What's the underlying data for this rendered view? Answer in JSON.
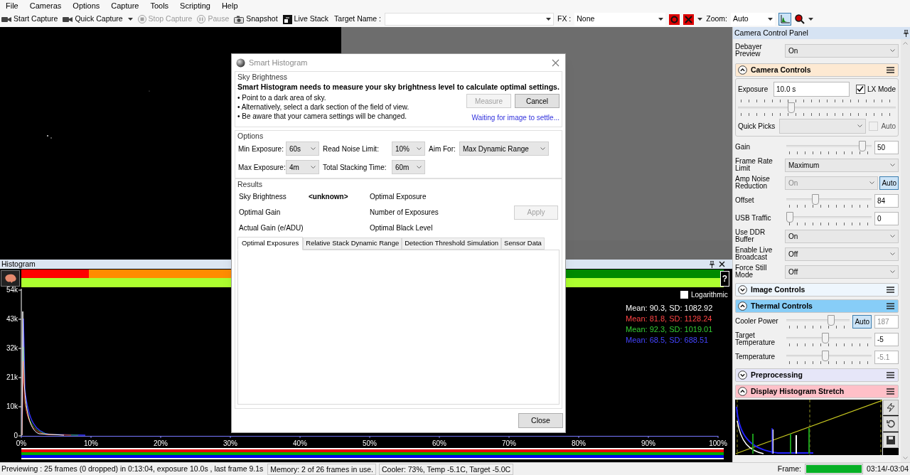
{
  "menu": [
    "File",
    "Cameras",
    "Options",
    "Capture",
    "Tools",
    "Scripting",
    "Help"
  ],
  "toolbar": {
    "buttons": [
      {
        "kind": "camera",
        "label": "Start Capture",
        "disabled": false,
        "has_menu": false
      },
      {
        "kind": "camera",
        "label": "Quick Capture",
        "disabled": false,
        "has_menu": true
      },
      {
        "kind": "stop",
        "label": "Stop Capture",
        "disabled": true,
        "has_menu": false
      },
      {
        "kind": "pause",
        "label": "Pause",
        "disabled": true,
        "has_menu": false
      },
      {
        "kind": "snapshot",
        "label": "Snapshot",
        "disabled": false,
        "has_menu": false
      },
      {
        "kind": "stack",
        "label": "Live Stack",
        "disabled": false,
        "has_menu": false
      }
    ],
    "target_name": {
      "label": "Target Name :"
    },
    "fx": {
      "label": "FX :",
      "value": "None"
    },
    "zoom": {
      "label": "Zoom:",
      "value": "Auto"
    },
    "histogram_toggle": {
      "selected": true
    }
  },
  "histogram": {
    "title": "Histogram",
    "help": "?",
    "logarithmic": {
      "label": "Logarithmic",
      "checked": false
    },
    "stats": [
      {
        "text": "Mean: 90.3, SD: 1082.92",
        "color": "#ffffff"
      },
      {
        "text": "Mean: 81.8, SD: 1128.24",
        "color": "#ff4444"
      },
      {
        "text": "Mean: 92.3, SD: 1019.01",
        "color": "#33cc33"
      },
      {
        "text": "Mean: 68.5, SD: 688.51",
        "color": "#4444ff"
      }
    ],
    "y_ticks": [
      "54k",
      "43k",
      "32k",
      "21k",
      "10k",
      "0"
    ],
    "x_ticks": [
      "0%",
      "10%",
      "20%",
      "30%",
      "40%",
      "50%",
      "60%",
      "70%",
      "80%",
      "90%",
      "100%"
    ]
  },
  "dialog": {
    "title": "Smart Histogram",
    "sky_brightness": {
      "legend": "Sky Brightness",
      "headline": "Smart Histogram needs to measure your sky brightness level to calculate optimal settings.",
      "bullets": [
        "• Point to a dark area of sky.",
        "• Alternatively, select a dark section of the field of view.",
        "• Be aware that your camera settings will be changed."
      ],
      "buttons": [
        {
          "label": "Measure",
          "disabled": true
        },
        {
          "label": "Cancel",
          "disabled": false
        }
      ],
      "status": "Waiting for image to settle..."
    },
    "options": {
      "legend": "Options",
      "fields": [
        {
          "label": "Min Exposure:",
          "value": "60s"
        },
        {
          "label": "Read Noise Limit:",
          "value": "10%"
        },
        {
          "label": "Aim For:",
          "value": "Max Dynamic Range"
        },
        {
          "label": "Max Exposure:",
          "value": "4m"
        },
        {
          "label": "Total Stacking Time:",
          "value": "60m"
        }
      ]
    },
    "results": {
      "legend": "Results",
      "items": [
        {
          "label": "Sky Brightness",
          "value": "<unknown>"
        },
        {
          "label": "Optimal Exposure"
        },
        {
          "label": "Optimal Gain"
        },
        {
          "label": "Number of Exposures"
        },
        {
          "label": "Actual Gain (e/ADU)"
        },
        {
          "label": "Optimal Black Level"
        }
      ],
      "apply": {
        "label": "Apply",
        "disabled": true
      }
    },
    "tabs": [
      {
        "label": "Optimal Exposures",
        "selected": true
      },
      {
        "label": "Relative Stack Dynamic Range",
        "selected": false
      },
      {
        "label": "Detection Threshold Simulation",
        "selected": false
      },
      {
        "label": "Sensor Data",
        "selected": false
      }
    ],
    "close": "Close"
  },
  "camera_panel": {
    "title": "Camera Control Panel",
    "rows": [
      {
        "kind": "select",
        "label": "Debayer Preview",
        "value": "On",
        "disabled": false
      }
    ],
    "sections": [
      {
        "title": "Camera Controls",
        "expanded": true,
        "color": "#fde9d2",
        "rows": [
          {
            "kind": "exposure",
            "label": "Exposure",
            "value": "10.0 s",
            "lx_mode": {
              "label": "LX Mode",
              "checked": true
            },
            "level": 0.33,
            "quick_picks": {
              "label": "Quick Picks"
            },
            "auto": {
              "label": "Auto",
              "checked": false
            }
          },
          {
            "kind": "slider",
            "label": "Gain",
            "level": 0.93,
            "value": "50",
            "disabled": false
          },
          {
            "kind": "select",
            "label": "Frame Rate Limit",
            "value": "Maximum",
            "disabled": false
          },
          {
            "kind": "select",
            "label": "Amp Noise Reduction",
            "value": "On",
            "disabled": true,
            "auto": {
              "label": "Auto",
              "selected": true
            }
          },
          {
            "kind": "slider",
            "label": "Offset",
            "level": 0.33,
            "value": "84",
            "disabled": false
          },
          {
            "kind": "slider",
            "label": "USB Traffic",
            "level": 0,
            "value": "0",
            "disabled": false
          },
          {
            "kind": "select",
            "label": "Use DDR Buffer",
            "value": "On",
            "disabled": false
          },
          {
            "kind": "select",
            "label": "Enable Live Broadcast",
            "value": "Off",
            "disabled": false
          },
          {
            "kind": "select",
            "label": "Force Still Mode",
            "value": "Off",
            "disabled": false
          }
        ]
      },
      {
        "title": "Image Controls",
        "expanded": false,
        "color": "#eef6fd"
      },
      {
        "title": "Thermal Controls",
        "expanded": true,
        "color": "#87cdf7",
        "rows": [
          {
            "kind": "slider",
            "label": "Cooler Power",
            "level": 0.73,
            "value": "187",
            "disabled": true,
            "auto": {
              "label": "Auto",
              "selected": true
            }
          },
          {
            "kind": "slider",
            "label": "Target Temperature",
            "level": 0.45,
            "value": "-5",
            "disabled": false
          },
          {
            "kind": "slider",
            "label": "Temperature",
            "level": 0.45,
            "value": "-5.1",
            "disabled": true
          }
        ]
      },
      {
        "title": "Preprocessing",
        "expanded": false,
        "color": "#e6e6f8"
      },
      {
        "title": "Display Histogram Stretch",
        "expanded": true,
        "color": "#ffc0c8",
        "rows": [
          {
            "kind": "stretch"
          }
        ]
      }
    ]
  },
  "status_bar": {
    "messages": [
      "Previewing : 25 frames (0 dropped) in 0:13:04, exposure 10.0s , last frame 9.1s",
      "Memory: 2 of 26 frames in use.",
      "Cooler: 73%, Temp -5.1C, Target -5.0C"
    ],
    "frame": {
      "label": "Frame:",
      "level": 1,
      "time": "03:14/-03:04"
    }
  }
}
